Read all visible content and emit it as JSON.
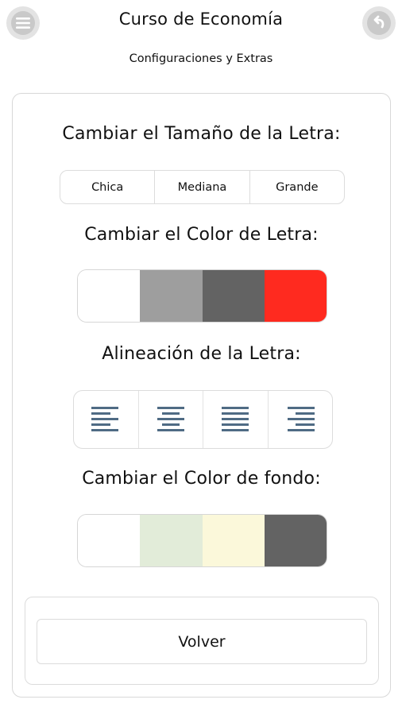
{
  "header": {
    "title": "Curso de Economía",
    "subtitle": "Configuraciones y Extras",
    "menu_icon": "hamburger-menu-icon",
    "back_icon": "back-arrow-icon"
  },
  "font_size": {
    "title": "Cambiar el Tamaño de la Letra:",
    "options": [
      "Chica",
      "Mediana",
      "Grande"
    ]
  },
  "text_color": {
    "title": "Cambiar el Color de Letra:",
    "colors": [
      "#ffffff",
      "#9e9e9e",
      "#636363",
      "#ff2a1f"
    ]
  },
  "alignment": {
    "title": "Alineación de la Letra:",
    "options": [
      "align-left-icon",
      "align-center-icon",
      "align-justify-icon",
      "align-right-icon"
    ],
    "icon_color": "#4f6b84"
  },
  "background_color": {
    "title": "Cambiar el Color de fondo:",
    "colors": [
      "#ffffff",
      "#e2ecd9",
      "#fbf8da",
      "#636363"
    ]
  },
  "footer": {
    "back_button": "Volver"
  }
}
